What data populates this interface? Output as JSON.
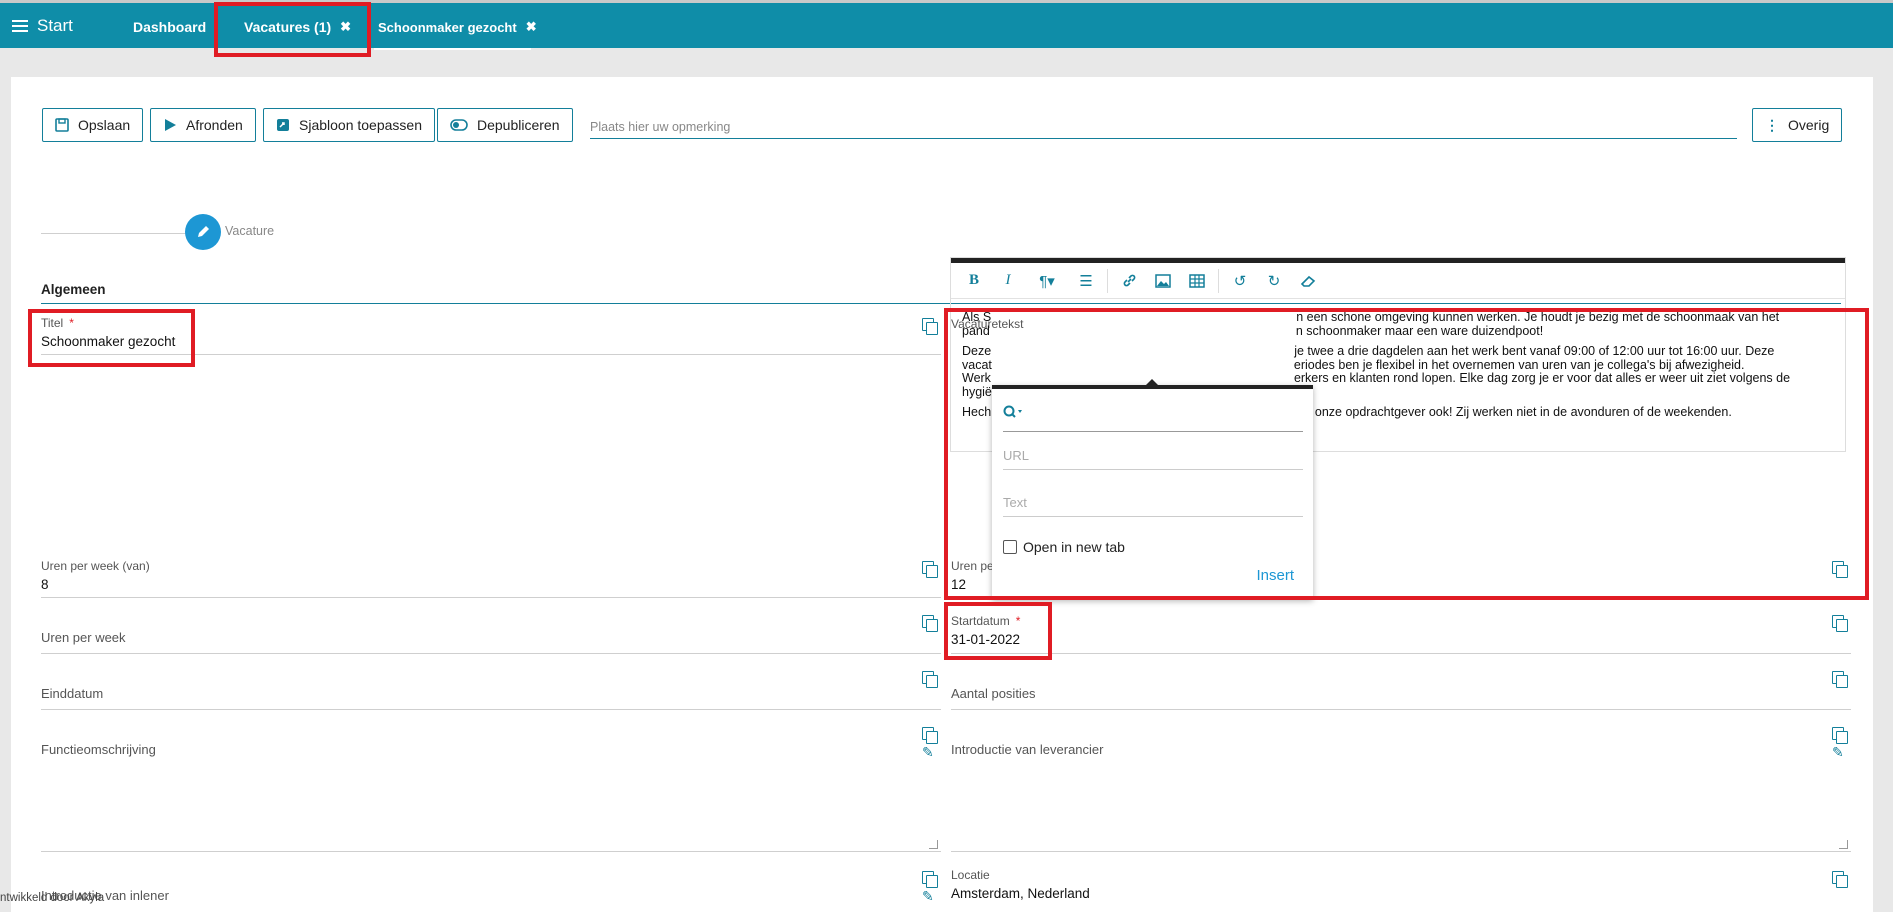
{
  "topbar": {
    "start_label": "Start",
    "tabs": [
      {
        "label": "Dashboard"
      },
      {
        "label": "Vacatures (1)",
        "close": "✖"
      },
      {
        "label": "Schoonmaker gezocht",
        "close": "✖"
      }
    ]
  },
  "toolbar": {
    "save": "Opslaan",
    "finish": "Afronden",
    "template": "Sjabloon toepassen",
    "depublish": "Depubliceren",
    "remark_placeholder": "Plaats hier uw opmerking",
    "more": "Overig"
  },
  "stepper": {
    "label": "Vacature"
  },
  "section_title": "Algemeen",
  "fields": {
    "titel": {
      "label": "Titel",
      "required": "*",
      "value": "Schoonmaker gezocht"
    },
    "uren_van": {
      "label": "Uren per week (van)",
      "value": "8"
    },
    "uren_week": {
      "label": "Uren per week",
      "value": ""
    },
    "einddatum": {
      "label": "Einddatum",
      "value": ""
    },
    "functie": {
      "label": "Functieomschrijving",
      "value": ""
    },
    "introductie_inlener": {
      "label": "Introductie van inlener",
      "value": ""
    },
    "vacaturetekst": {
      "label": "Vacaturetekst"
    },
    "uren_tot": {
      "label": "Uren pe",
      "value": "12"
    },
    "startdatum": {
      "label": "Startdatum",
      "required": "*",
      "value": "31-01-2022"
    },
    "aantal_posities": {
      "label": "Aantal posities",
      "value": ""
    },
    "introductie_leverancier": {
      "label": "Introductie van leverancier",
      "value": ""
    },
    "locatie": {
      "label": "Locatie",
      "value": "Amsterdam, Nederland"
    }
  },
  "editor": {
    "paragraphs": [
      [
        "Als S",
        "n een schone omgeving kunnen werken. Je houdt je bezig met de schoonmaak van het"
      ],
      [
        "pand",
        "n schoonmaker maar een ware duizendpoot!"
      ],
      [
        "Deze",
        "je twee a drie dagdelen aan het werk bent vanaf 09:00 of 12:00 uur tot 16:00 uur. Deze"
      ],
      [
        "vacat",
        "eriodes ben je flexibel in het overnemen van uren van je collega's bij afwezigheid."
      ],
      [
        "Werk",
        "erkers en klanten rond lopen. Elke dag zorg je er voor dat alles er weer uit ziet volgens de"
      ],
      [
        "hygië",
        ""
      ],
      [
        "Hech",
        "bi, onze opdrachtgever ook! Zij werken niet in de avonduren of de weekenden."
      ]
    ]
  },
  "link_popup": {
    "url_placeholder": "URL",
    "text_placeholder": "Text",
    "new_tab_label": "Open in new tab",
    "insert_label": "Insert"
  },
  "footer_text": "ntwikkeld door Akyla",
  "colors": {
    "brand": "#0f8da8",
    "highlight": "#e01c24",
    "accent": "#1d97d4"
  }
}
